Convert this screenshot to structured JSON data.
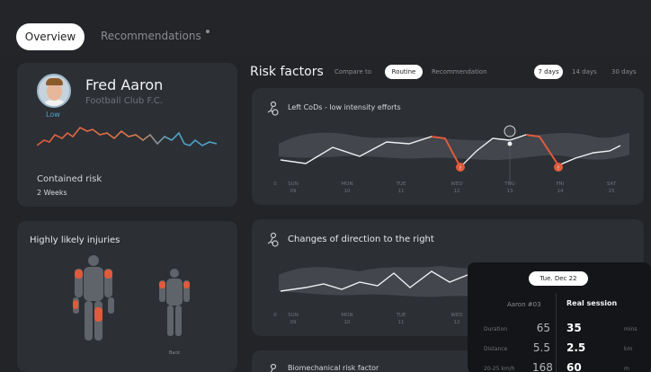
{
  "tabs": {
    "overview": "Overview",
    "recommendations": "Recommendations"
  },
  "player": {
    "name": "Fred Aaron",
    "club": "Football Club F.C.",
    "risk_level": "Low",
    "risk_title": "Contained risk",
    "risk_duration": "2 Weeks"
  },
  "injuries": {
    "title": "Highly likely injuries",
    "back_label": "Back"
  },
  "risk_factors": {
    "title": "Risk factors",
    "compare_label": "Compare to",
    "routine": "Routine",
    "recommendation": "Recommendation",
    "range_7": "7 days",
    "range_14": "14 days",
    "range_30": "30 days"
  },
  "charts": {
    "card1_title": "Left CoDs - low intensity efforts",
    "card2_title": "Changes of direction to the right",
    "card3_title": "Biomechanical risk factor",
    "zero": "0",
    "days": [
      {
        "name": "SUN",
        "num": "09"
      },
      {
        "name": "MON",
        "num": "10"
      },
      {
        "name": "TUE",
        "num": "11"
      },
      {
        "name": "WED",
        "num": "12"
      },
      {
        "name": "THU",
        "num": "13"
      },
      {
        "name": "FRI",
        "num": "14"
      },
      {
        "name": "SAT",
        "num": "15"
      }
    ],
    "alert_mark": "!"
  },
  "tooltip": {
    "date": "Tue. Dec 22",
    "col1": "Aaron #03",
    "col2": "Real session",
    "rows": [
      {
        "label": "Duration",
        "v1": "65",
        "v2": "35",
        "unit": "mins"
      },
      {
        "label": "Distance",
        "v1": "5.5",
        "v2": "2.5",
        "unit": "km"
      },
      {
        "label": "20-25 km/h",
        "v1": "168",
        "v2": "60",
        "unit": "m"
      }
    ]
  },
  "colors": {
    "background": "#222428",
    "card": "#2c2f34",
    "accent_red": "#e05a3c",
    "accent_blue": "#4da3c7",
    "tooltip_bg": "#141518"
  }
}
